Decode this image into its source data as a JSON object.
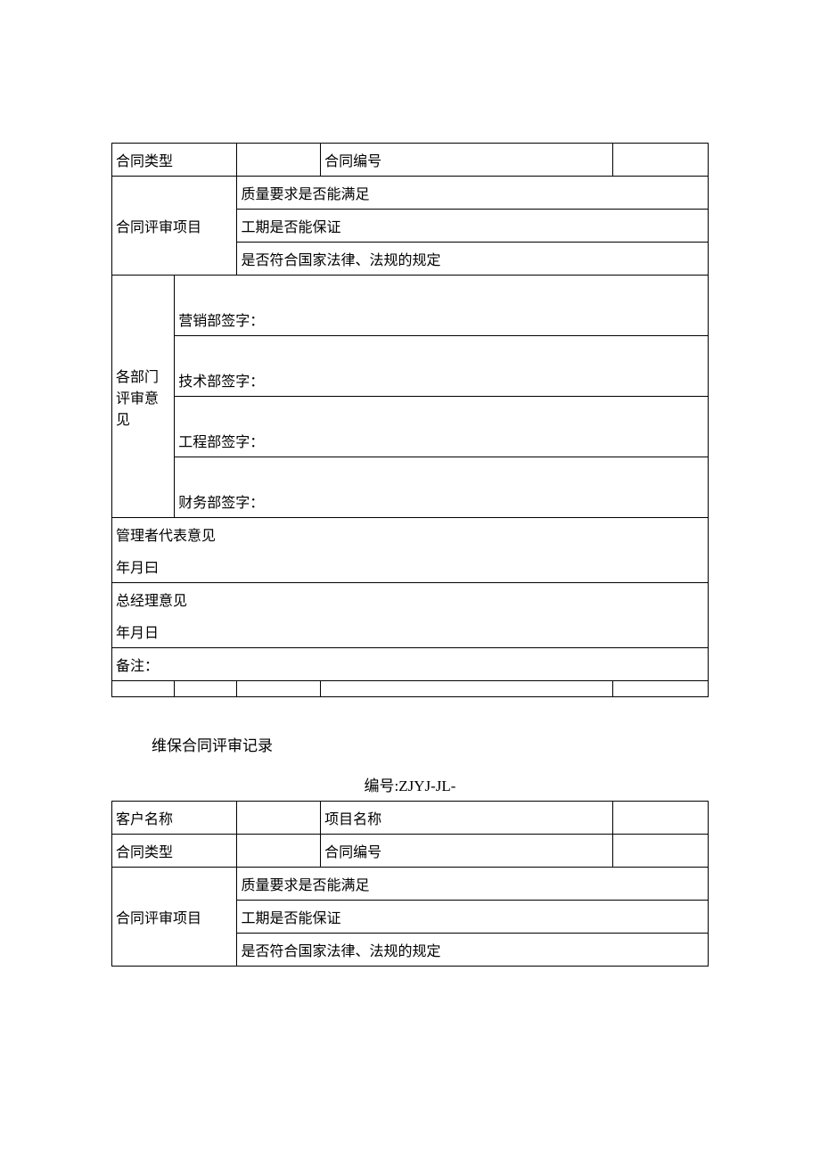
{
  "table1": {
    "row1": {
      "c1": "合同类型",
      "c3": "合同编号"
    },
    "row2": {
      "c1": "合同评审项目",
      "item1": "质量要求是否能满足",
      "item2": "工期是否能保证",
      "item3": "是否符合国家法律、法规的规定"
    },
    "row3": {
      "c1": "各部门评审意见",
      "sign1": "营销部签字：",
      "sign2": "技术部签字：",
      "sign3": "工程部签字：",
      "sign4": "财务部签字："
    },
    "row4": {
      "line1": "管理者代表意见",
      "line2": "年月曰"
    },
    "row5": {
      "line1": "总经理意见",
      "line2": "年月日"
    },
    "row6": {
      "c1": "备注："
    }
  },
  "sectionTitle": "维保合同评审记录",
  "docNumber": "编号:ZJYJ-JL-",
  "table2": {
    "row1": {
      "c1": "客户名称",
      "c3": "项目名称"
    },
    "row2": {
      "c1": "合同类型",
      "c3": "合同编号"
    },
    "row3": {
      "c1": "合同评审项目",
      "item1": "质量要求是否能满足",
      "item2": "工期是否能保证",
      "item3": "是否符合国家法律、法规的规定"
    }
  }
}
